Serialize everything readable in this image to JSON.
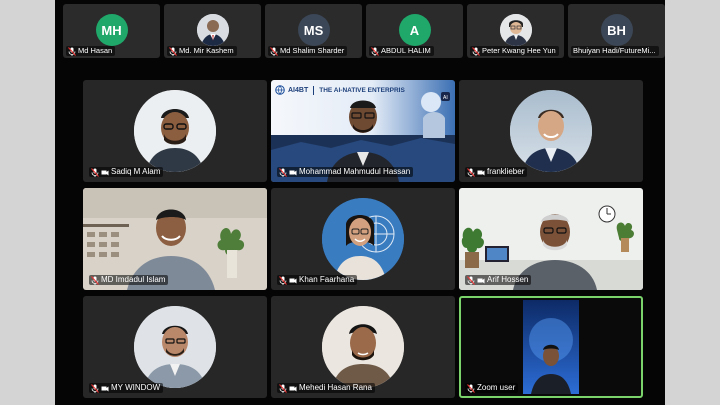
{
  "top_strip": [
    {
      "name": "Md Hasan",
      "initials": "MH",
      "color": "#1fa86a"
    },
    {
      "name": "Md. Mir Kashem",
      "initials": "",
      "color": ""
    },
    {
      "name": "Md Shalim Sharder",
      "initials": "MS",
      "color": "#3b4656"
    },
    {
      "name": "ABDUL HALIM",
      "initials": "A",
      "color": "#1fa86a"
    },
    {
      "name": "Peter Kwang Hee Yun",
      "initials": "",
      "color": ""
    },
    {
      "name": "Bhuiyan Hadi/FutureMi...",
      "initials": "BH",
      "color": "#3b4656"
    }
  ],
  "grid": [
    {
      "name": "Sadiq M Alam"
    },
    {
      "name": "Mohammad Mahmudul Hassan",
      "banner_logo": "AI4BT",
      "banner_title": "THE AI-NATIVE ENTERPRIS"
    },
    {
      "name": "franklieber"
    },
    {
      "name": "MD Imdadul Islam"
    },
    {
      "name": "Khan Faarhana"
    },
    {
      "name": "Arif Hossen"
    },
    {
      "name": "MY WINDOW"
    },
    {
      "name": "Mehedi Hasan Rana"
    },
    {
      "name": "Zoom user"
    }
  ]
}
